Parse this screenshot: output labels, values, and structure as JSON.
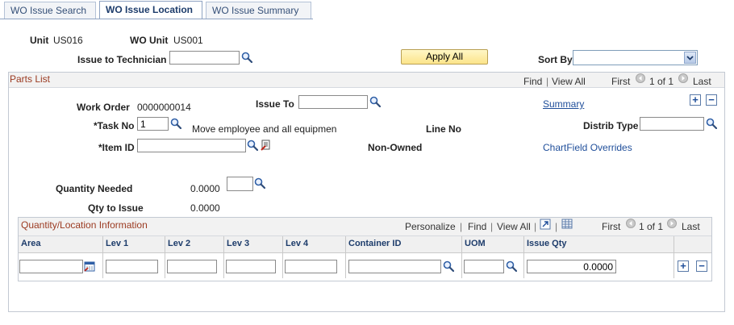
{
  "tabs": [
    {
      "label": "WO Issue Search"
    },
    {
      "label": "WO Issue Location"
    },
    {
      "label": "WO Issue Summary"
    }
  ],
  "header": {
    "unit_label": "Unit",
    "unit_value": "US016",
    "wo_unit_label": "WO Unit",
    "wo_unit_value": "US001",
    "issue_to_tech_label": "Issue to Technician",
    "issue_to_tech_value": "",
    "apply_all_label": "Apply All",
    "sort_by_label": "Sort By",
    "sort_by_value": ""
  },
  "parts_list": {
    "title": "Parts List",
    "find": "Find",
    "separator": "|",
    "view_all": "View All",
    "first": "First",
    "page_info": "1 of 1",
    "last": "Last",
    "work_order_label": "Work Order",
    "work_order_value": "0000000014",
    "issue_to_label": "Issue To",
    "issue_to_value": "",
    "summary_link": "Summary",
    "task_no_label": "*Task No",
    "task_no_value": "1",
    "task_desc": "Move employee and all equipmen",
    "line_no_label": "Line No",
    "distrib_type_label": "Distrib Type",
    "distrib_type_value": "",
    "item_id_label": "*Item ID",
    "item_id_value": "",
    "non_owned_label": "Non-Owned",
    "chartfield_link": "ChartField Overrides",
    "qty_needed_label": "Quantity Needed",
    "qty_needed_value": "0.0000",
    "qty_needed_uom": "",
    "qty_to_issue_label": "Qty to Issue",
    "qty_to_issue_value": "0.0000"
  },
  "qty_location": {
    "title": "Quantity/Location Information",
    "personalize": "Personalize",
    "find": "Find",
    "view_all": "View All",
    "separator": "|",
    "first": "First",
    "page_info": "1 of 1",
    "last": "Last",
    "columns": [
      "Area",
      "Lev 1",
      "Lev 2",
      "Lev 3",
      "Lev 4",
      "Container ID",
      "UOM",
      "Issue Qty"
    ],
    "row": {
      "area": "",
      "lev1": "",
      "lev2": "",
      "lev3": "",
      "lev4": "",
      "container_id": "",
      "uom": "",
      "issue_qty": "0.0000"
    }
  },
  "icons": {
    "lookup": "magnifier-icon",
    "calendar": "calendar-icon",
    "detail": "detail-icon",
    "add": "plus-icon",
    "remove": "minus-icon",
    "prev": "prev-arrow-icon",
    "next": "next-arrow-icon",
    "download": "download-icon",
    "grid": "grid-icon"
  },
  "colors": {
    "title_red": "#9b3a21",
    "link_blue": "#1f4e9a",
    "apply_button": "#fce48a"
  }
}
